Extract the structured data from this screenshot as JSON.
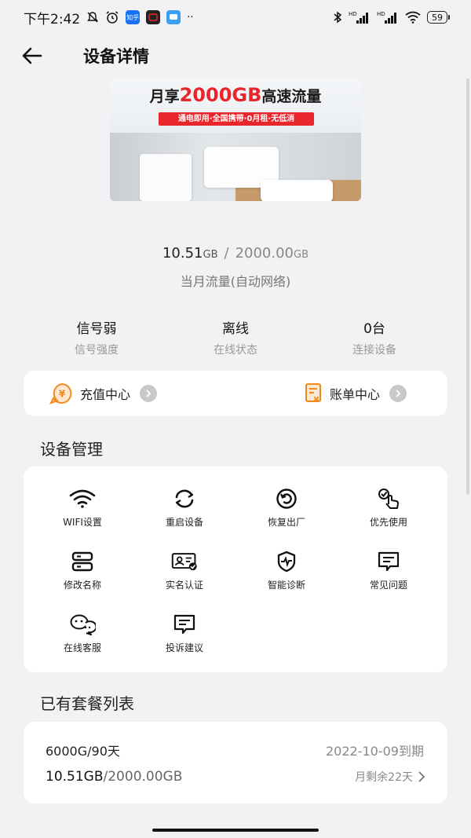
{
  "status_bar": {
    "time": "下午2:42",
    "zhihu_label": "知乎",
    "battery": "59",
    "hd_label": "HD"
  },
  "header": {
    "title": "设备详情"
  },
  "banner": {
    "prefix": "月享",
    "highlight": "2000GB",
    "suffix": "高速流量",
    "strip": "通电即用·全国携带·0月租·无低消"
  },
  "usage": {
    "used": "10.51",
    "used_unit": "GB",
    "separator": "/",
    "total": "2000.00",
    "total_unit": "GB",
    "description": "当月流量(自动网络)"
  },
  "stats": [
    {
      "value": "信号弱",
      "label": "信号强度"
    },
    {
      "value": "离线",
      "label": "在线状态"
    },
    {
      "value": "0台",
      "label": "连接设备"
    }
  ],
  "actions": {
    "recharge": "充值中心",
    "bill": "账单中心"
  },
  "management": {
    "title": "设备管理",
    "items": [
      {
        "label": "WIFI设置",
        "icon": "wifi-icon"
      },
      {
        "label": "重启设备",
        "icon": "restart-icon"
      },
      {
        "label": "恢复出厂",
        "icon": "factory-reset-icon"
      },
      {
        "label": "优先使用",
        "icon": "priority-use-icon"
      },
      {
        "label": "修改名称",
        "icon": "rename-icon"
      },
      {
        "label": "实名认证",
        "icon": "id-verify-icon"
      },
      {
        "label": "智能诊断",
        "icon": "diagnosis-icon"
      },
      {
        "label": "常见问题",
        "icon": "faq-icon"
      },
      {
        "label": "在线客服",
        "icon": "customer-service-icon"
      },
      {
        "label": "投诉建议",
        "icon": "complaint-icon"
      }
    ]
  },
  "plans": {
    "title": "已有套餐列表",
    "items": [
      {
        "name": "6000G/90天",
        "expiry": "2022-10-09到期",
        "used": "10.51GB",
        "total": "/2000.00GB",
        "remaining": "月剩余22天"
      }
    ]
  },
  "colors": {
    "background": "#f2f2f4",
    "accent_orange": "#f08a1c",
    "banner_red": "#e8262c"
  }
}
